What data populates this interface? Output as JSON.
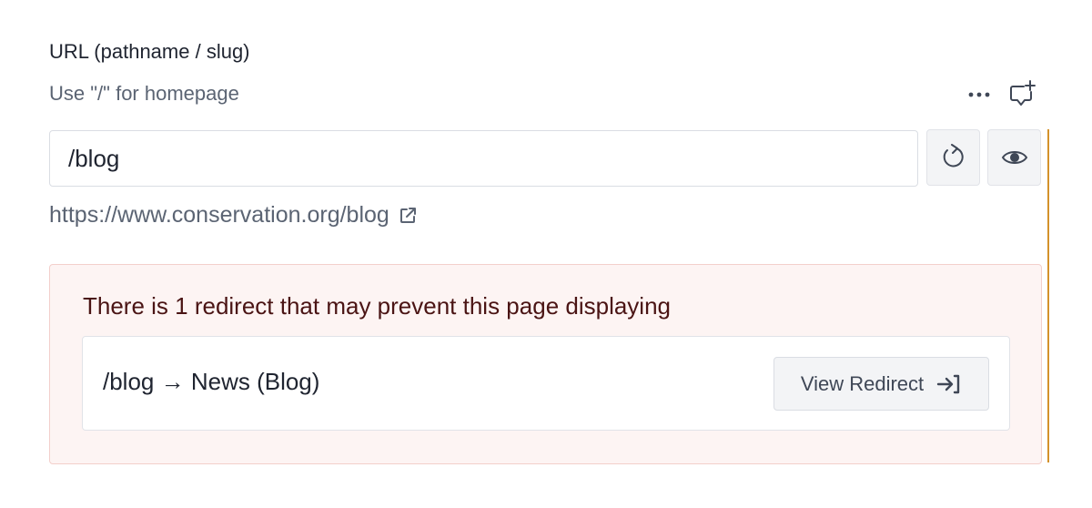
{
  "field": {
    "label": "URL (pathname / slug)",
    "help": "Use \"/\" for homepage",
    "value": "/blog",
    "public_url": "https://www.conservation.org/blog"
  },
  "alert": {
    "message": "There is 1 redirect that may prevent this page displaying",
    "redirect_path": "/blog → News (Blog)",
    "button_label": "View Redirect"
  },
  "icons": {
    "more": "more-horizontal-icon",
    "comment": "add-comment-icon",
    "regenerate": "regenerate-icon",
    "preview": "eye-icon",
    "external": "external-link-icon",
    "go_to": "arrow-right-to-bracket-icon"
  },
  "colors": {
    "accent_bar": "#d4922b",
    "alert_bg": "#fdf4f3",
    "alert_border": "#f3cfcb",
    "alert_text": "#4a1414"
  }
}
